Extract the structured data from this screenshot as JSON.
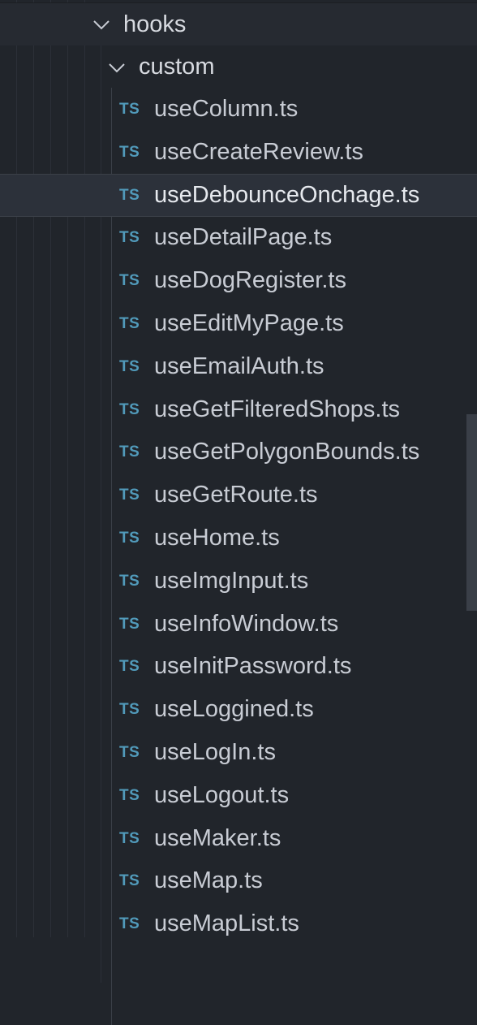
{
  "tree": {
    "hooks_folder": {
      "name": "hooks",
      "icon": "chevron-down-icon"
    },
    "custom_folder": {
      "name": "custom",
      "icon": "chevron-down-icon"
    },
    "file_icon": {
      "text": "TS",
      "color": "#519aba"
    },
    "selected_index": 2,
    "files": [
      "useColumn.ts",
      "useCreateReview.ts",
      "useDebounceOnchage.ts",
      "useDetailPage.ts",
      "useDogRegister.ts",
      "useEditMyPage.ts",
      "useEmailAuth.ts",
      "useGetFilteredShops.ts",
      "useGetPolygonBounds.ts",
      "useGetRoute.ts",
      "useHome.ts",
      "useImgInput.ts",
      "useInfoWindow.ts",
      "useInitPassword.ts",
      "useLoggined.ts",
      "useLogIn.ts",
      "useLogout.ts",
      "useMaker.ts",
      "useMap.ts",
      "useMapList.ts"
    ]
  },
  "colors": {
    "background": "#21252b",
    "selected_background": "#2c313a",
    "text": "#c8ccd4"
  }
}
